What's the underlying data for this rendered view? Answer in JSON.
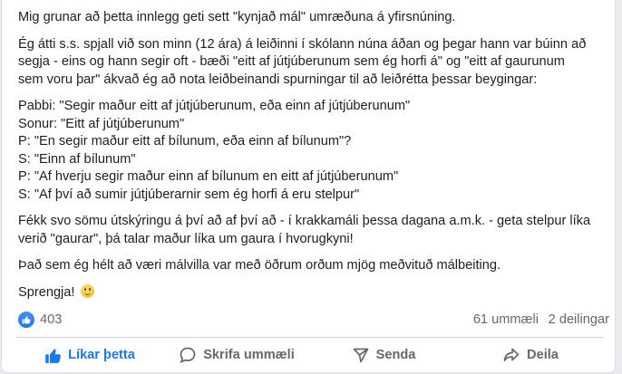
{
  "post": {
    "paragraphs": [
      [
        "Mig grunar að þetta innlegg geti sett \"kynjað mál\" umræðuna á yfirsnúning."
      ],
      [
        "Ég átti s.s. spjall við son minn (12 ára) á leiðinni í skólann núna áðan og þegar hann var búinn að",
        "segja - eins og hann segir oft - bæði \"eitt af jútjúberunum sem ég horfi á\" og \"eitt af gaurunum",
        "sem voru þar\" ákvað ég að nota leiðbeinandi spurningar til að leiðrétta þessar beygingar:"
      ],
      [
        "Pabbi: \"Segir maður eitt af jútjúberunum, eða einn af jútjúberunum\"",
        "Sonur: \"Eitt af jútjúberunum\"",
        "P: \"En segir maður eitt af bílunum, eða einn af bílunum\"?",
        "S: \"Einn af bílunum\"",
        "P: \"Af hverju segir maður einn af bílunum en eitt af jútjúberunum\"",
        "S: \"Af því að sumir jútjúberarnir sem ég horfi á eru stelpur\""
      ],
      [
        "Fékk svo sömu útskýringu á því að af því að - í krakkamáli þessa dagana a.m.k. - geta stelpur líka",
        "verið \"gaurar\", þá talar maður líka um gaura í hvorugkyni!"
      ],
      [
        "Það sem ég hélt að væri málvilla var með öðrum orðum mjög meðvituð málbeiting."
      ]
    ],
    "closing": "Sprengja!",
    "closing_emoji": "slightly-smiling-face-emoji"
  },
  "stats": {
    "likes": "403",
    "comments": "61 ummæli",
    "shares": "2 deilingar"
  },
  "actions": {
    "like": "Líkar þetta",
    "comment": "Skrifa ummæli",
    "send": "Senda",
    "share": "Deila"
  },
  "icons": {
    "like": "thumbs-up-icon",
    "comment": "speech-bubble-icon",
    "send": "send-icon",
    "share": "share-arrow-icon"
  },
  "colors": {
    "accent": "#1877f2",
    "text": "#1c1e21",
    "muted": "#65676b"
  }
}
